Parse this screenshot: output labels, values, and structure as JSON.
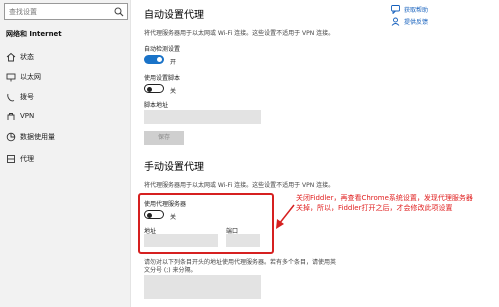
{
  "sidebar": {
    "search_placeholder": "查找设置",
    "section_title": "网络和 Internet",
    "items": [
      {
        "label": "状态",
        "icon": "home-icon"
      },
      {
        "label": "以太网",
        "icon": "ethernet-icon"
      },
      {
        "label": "拨号",
        "icon": "dialup-icon"
      },
      {
        "label": "VPN",
        "icon": "vpn-icon"
      },
      {
        "label": "数据使用量",
        "icon": "data-usage-icon"
      },
      {
        "label": "代理",
        "icon": "proxy-icon"
      }
    ]
  },
  "main": {
    "auto_title": "自动设置代理",
    "auto_desc": "将代理服务器用于以太网或 Wi-Fi 连接。这些设置不适用于 VPN 连接。",
    "auto_detect_label": "自动检测设置",
    "auto_detect_state": "开",
    "use_script_label": "使用设置脚本",
    "use_script_state": "关",
    "script_address_label": "脚本地址",
    "save_label": "保存",
    "manual_title": "手动设置代理",
    "manual_desc": "将代理服务器用于以太网或 Wi-Fi 连接。这些设置不适用于 VPN 连接。",
    "use_proxy_label": "使用代理服务器",
    "use_proxy_state": "关",
    "address_label": "地址",
    "port_label": "端口",
    "exceptions_line1": "请勿对以下列条目开头的地址使用代理服务器。若有多个条目，请使用英",
    "exceptions_line2": "文分号 (;) 来分隔。"
  },
  "right": {
    "help_label": "获取帮助",
    "feedback_label": "提供反馈"
  },
  "annotation": {
    "line1": "关闭Fiddler，再查看Chrome系统设置，发现代理服务器",
    "line2": "关掉，所以，Fiddler打开之后，才会修改此项设置"
  },
  "colors": {
    "accent": "#1a73c8",
    "annotation": "#d62020",
    "link": "#1560bd"
  }
}
